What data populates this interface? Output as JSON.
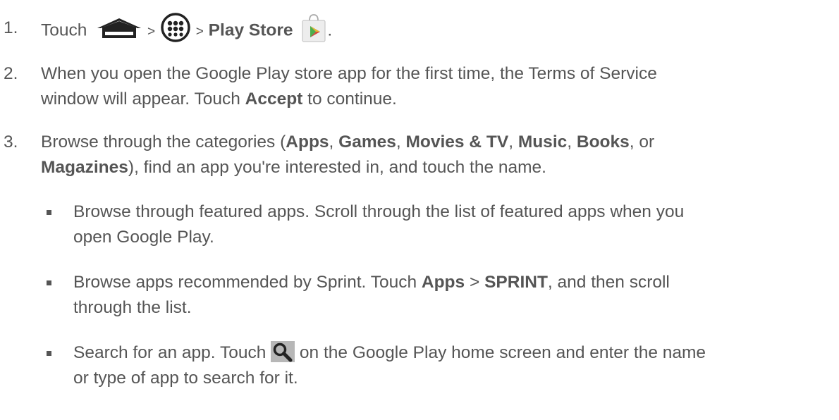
{
  "step1": {
    "number": "1.",
    "touch": "Touch",
    "sep1": ">",
    "sep2": ">",
    "play_store": "Play Store",
    "end": ".",
    "icons": [
      "home-icon",
      "apps-grid-icon",
      "play-store-icon"
    ]
  },
  "step2": {
    "number": "2.",
    "line1": "When you open the Google Play store app for the first time, the Terms of Service",
    "line2a": "window will appear. Touch ",
    "accept": "Accept",
    "line2b": " to continue."
  },
  "step3": {
    "number": "3.",
    "a": "Browse through the categories (",
    "apps": "Apps",
    "c1": ", ",
    "games": "Games",
    "c2": ", ",
    "movies": "Movies & TV",
    "c3": ", ",
    "music": "Music",
    "c4": ", ",
    "books": "Books",
    "c5": ", or",
    "magazines": "Magazines",
    "b": "), find an app you're interested in, and touch the name."
  },
  "bullets": [
    {
      "line1": "Browse through featured apps. Scroll through the list of featured apps when you",
      "line2": "open Google Play."
    },
    {
      "a": "Browse apps recommended by Sprint. Touch ",
      "apps": "Apps",
      "sep": " > ",
      "sprint": "SPRINT",
      "b": ", and then scroll",
      "line2": "through the list."
    },
    {
      "a": "Search for an app. Touch ",
      "b": " on the Google Play home screen and enter the name",
      "line2": "or type of app to search for it.",
      "icon": "search-icon"
    }
  ]
}
